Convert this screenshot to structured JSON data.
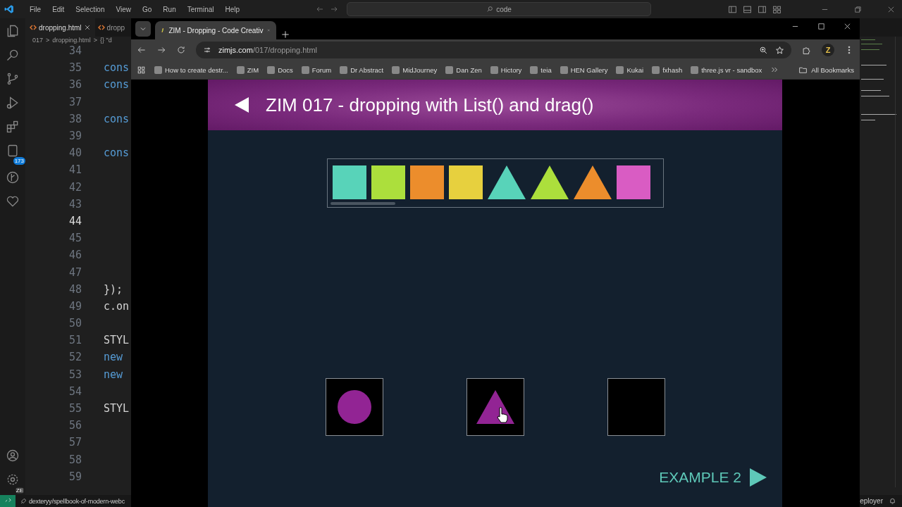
{
  "vscode": {
    "menu": [
      "File",
      "Edit",
      "Selection",
      "View",
      "Go",
      "Run",
      "Terminal",
      "Help"
    ],
    "search": {
      "value": "code"
    },
    "activity_bar": {
      "badge": "173",
      "account_badge": "ZE"
    },
    "tabs": [
      {
        "label": "dropping.html",
        "selected": true
      },
      {
        "label": "dropp",
        "selected": false
      }
    ],
    "breadcrumb": [
      "017",
      ">",
      "dropping.html",
      ">",
      "{} \"d"
    ],
    "lines": [
      {
        "number": "34",
        "current": false
      },
      {
        "number": "35",
        "code": "cons",
        "current": false
      },
      {
        "number": "36",
        "code": "cons",
        "current": false
      },
      {
        "number": "37",
        "current": false
      },
      {
        "number": "38",
        "code": "cons",
        "current": false
      },
      {
        "number": "39",
        "current": false
      },
      {
        "number": "40",
        "code": "cons",
        "current": false
      },
      {
        "number": "41",
        "current": false
      },
      {
        "number": "42",
        "current": false
      },
      {
        "number": "43",
        "current": false
      },
      {
        "number": "44",
        "current": true
      },
      {
        "number": "45",
        "current": false
      },
      {
        "number": "46",
        "current": false
      },
      {
        "number": "47",
        "current": false
      },
      {
        "number": "48",
        "code": "});",
        "current": false
      },
      {
        "number": "49",
        "code": "c.on",
        "current": false
      },
      {
        "number": "50",
        "current": false
      },
      {
        "number": "51",
        "code": "STYL",
        "current": false
      },
      {
        "number": "52",
        "code": "new",
        "current": false
      },
      {
        "number": "53",
        "code": "new",
        "current": false
      },
      {
        "number": "54",
        "current": false
      },
      {
        "number": "55",
        "code": "STYL",
        "current": false
      },
      {
        "number": "56",
        "current": false
      },
      {
        "number": "57",
        "current": false
      },
      {
        "number": "58",
        "current": false
      },
      {
        "number": "59",
        "current": false
      }
    ],
    "status_bar": {
      "left": "dexteryy/spellbook-of-modern-webc",
      "right": "eployer"
    }
  },
  "browser": {
    "tab": {
      "title": "ZIM - Dropping - Code Creativ",
      "selected": true
    },
    "address": {
      "host": "zimjs.com",
      "path": "/017/dropping.html"
    },
    "bookmarks": [
      "How to create destr...",
      "ZIM",
      "Docs",
      "Forum",
      "Dr Abstract",
      "MidJourney",
      "Dan Zen",
      "Hictory",
      "teia",
      "HEN Gallery",
      "Kukai",
      "fxhash",
      "three.js vr - sandbox"
    ],
    "all_bookmarks": "All Bookmarks",
    "profile": "Z",
    "page": {
      "title": "ZIM 017 - dropping with List() and drag()",
      "list_items": [
        {
          "kind": "square",
          "color": "#58d3b9"
        },
        {
          "kind": "square",
          "color": "#acdf3c"
        },
        {
          "kind": "square",
          "color": "#ec8d2c"
        },
        {
          "kind": "square",
          "color": "#e7d03e"
        },
        {
          "kind": "triangle",
          "color": "#58d3b9"
        },
        {
          "kind": "triangle",
          "color": "#acdf3c"
        },
        {
          "kind": "triangle",
          "color": "#ec8d2c"
        },
        {
          "kind": "square",
          "color": "#d95cc3"
        }
      ],
      "targets": [
        {
          "kind": "circle",
          "color": "#922494"
        },
        {
          "kind": "triangle",
          "color": "#922494"
        },
        {
          "kind": "empty"
        }
      ],
      "next_label": "EXAMPLE 2"
    }
  }
}
